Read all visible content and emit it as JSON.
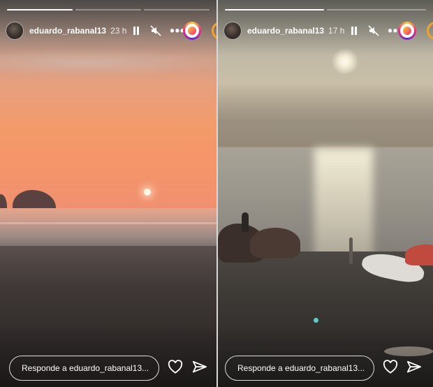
{
  "stories": [
    {
      "username": "eduardo_rabanal13",
      "time_ago": "23 h",
      "reply_placeholder": "Responde a eduardo_rabanal13...",
      "progress": [
        1.0,
        0.0,
        0.0
      ],
      "icons": {
        "avatar": "avatar",
        "pause": "pause-icon",
        "mute": "speaker-muted-icon",
        "more": "more-icon",
        "live": "story-ring-icon",
        "like": "heart-icon",
        "share": "send-icon"
      }
    },
    {
      "username": "eduardo_rabanal13",
      "time_ago": "17 h",
      "reply_placeholder": "Responde a eduardo_rabanal13...",
      "progress": [
        1.0,
        0.0
      ],
      "icons": {
        "avatar": "avatar",
        "pause": "pause-icon",
        "mute": "speaker-muted-icon",
        "more": "more-icon",
        "live": "story-ring-icon",
        "like": "heart-icon",
        "share": "send-icon"
      }
    }
  ],
  "colors": {
    "text": "#ffffff",
    "ring_gradient": [
      "#f9ce34",
      "#ee2a7b",
      "#6228d7"
    ],
    "next_ring": "#f3a32a"
  }
}
